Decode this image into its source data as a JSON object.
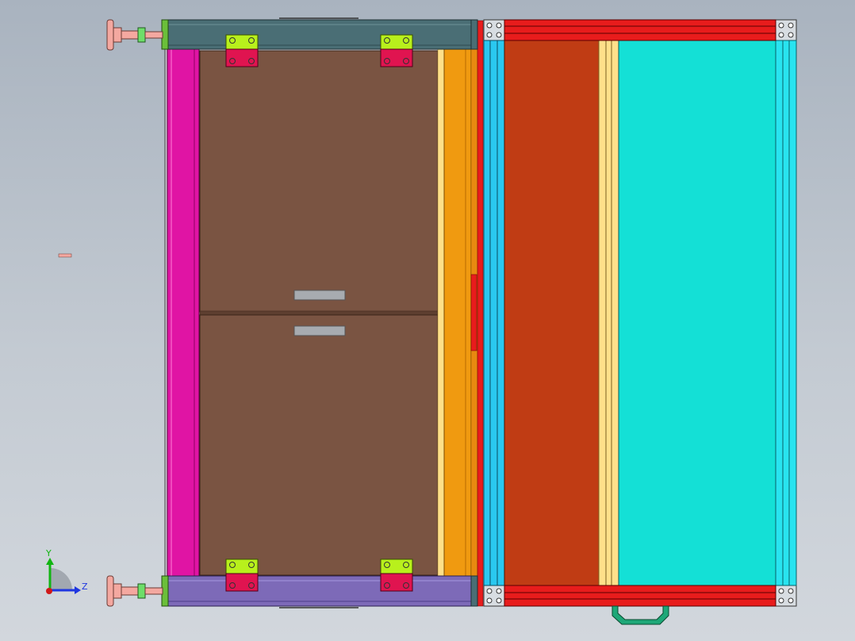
{
  "view": {
    "background_top": "#a9b3bf",
    "background_bottom": "#d2d7dd"
  },
  "triad": {
    "x_axis_label": "Z",
    "y_axis_label": "Y",
    "colors": {
      "y": "#12b512",
      "z": "#1f36e0",
      "x": "#d01818"
    }
  },
  "parts": {
    "left_frame_rail": "#e014a4",
    "door_panel": "#7a5442",
    "door_seam": "#5e3f30",
    "handle": "#a7abb0",
    "hinge_top": "#b8f01c",
    "hinge_bottom": "#e01450",
    "top_beam": "#4a6e75",
    "bottom_beam": "#7d6ab8",
    "end_cap": "#6bbf3a",
    "orange_rail": "#f09a10",
    "red_strip": "#e81c1c",
    "blue_rail": "#2ac8f0",
    "rust_panel": "#c03c14",
    "cream_rail": "#ffe08a",
    "teal_panel": "#14e0d6",
    "cyan_rail": "#28e4f0",
    "foot_pad": "#f4a8a0",
    "foot_nut": "#6ede6a",
    "bottom_handle": "#1ea878"
  }
}
